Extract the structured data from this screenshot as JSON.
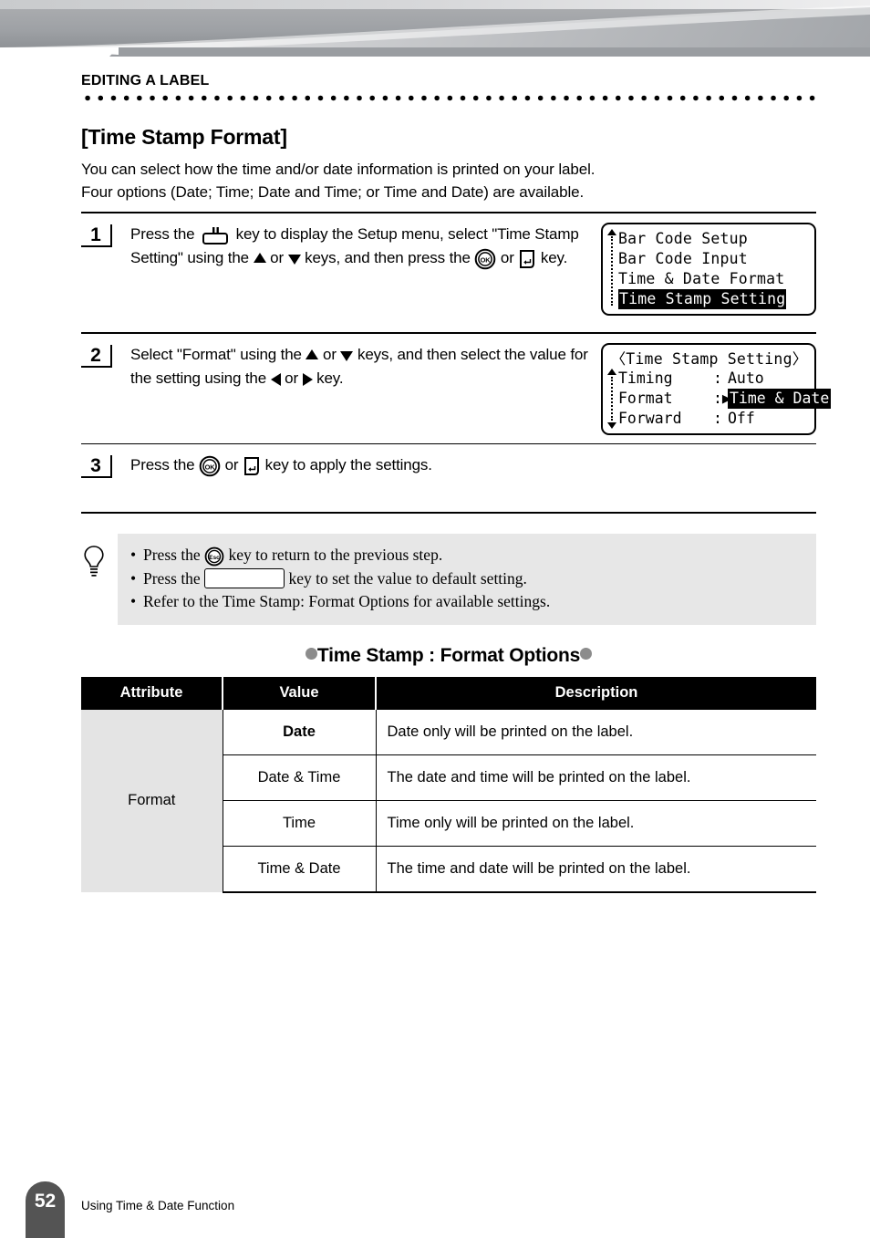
{
  "header": {
    "section_title": "EDITING A LABEL"
  },
  "topic": {
    "title": "[Time Stamp Format]",
    "intro_line1": "You can select how the time and/or date information is printed on your label.",
    "intro_line2": "Four options (Date; Time; Date and Time; or Time and Date) are available."
  },
  "steps": [
    {
      "number": "1",
      "text_a": "Press the",
      "key_1": "setup-key",
      "text_b": "key to display the Setup menu, select \"Time Stamp Setting\" using the",
      "text_c": "or",
      "text_d": "keys, and then press the",
      "text_e": "or",
      "text_f": "key."
    },
    {
      "number": "2",
      "text_a": "Select \"Format\" using the",
      "text_b": "or",
      "text_c": "keys, and then select the value for the setting using the",
      "text_d": "or",
      "text_e": "key."
    },
    {
      "number": "3",
      "text_a": "Press the",
      "text_b": "or",
      "text_c": "key to apply the settings."
    }
  ],
  "lcd1": {
    "lines": [
      "Bar Code Setup",
      "Bar Code Input",
      "Time & Date Format"
    ],
    "selected": "Time Stamp Setting"
  },
  "lcd2": {
    "title": "〈Time Stamp Setting〉",
    "rows": [
      {
        "key": "Timing",
        "sep": ":",
        "value": "Auto",
        "highlight": false
      },
      {
        "key": "Format",
        "sep": ":▶",
        "value": "Time & Date",
        "highlight": true
      },
      {
        "key": "Forward",
        "sep": ":",
        "value": "Off",
        "highlight": false
      }
    ]
  },
  "note": {
    "item1_a": "Press the",
    "item1_b": "key to return to the previous step.",
    "item2_a": "Press the",
    "item2_b": "key to set the value to default setting.",
    "item3": "Refer to the Time Stamp: Format Options for available settings."
  },
  "options_table": {
    "title": "Time Stamp : Format Options",
    "headers": [
      "Attribute",
      "Value",
      "Description"
    ],
    "attribute": "Format",
    "rows": [
      {
        "value": "Date",
        "description": "Date only will be printed on the label.",
        "default": true
      },
      {
        "value": "Date & Time",
        "description": "The date and time will be printed on the label.",
        "default": false
      },
      {
        "value": "Time",
        "description": "Time only will be printed on the label.",
        "default": false
      },
      {
        "value": "Time & Date",
        "description": "The time and date will be printed on the label.",
        "default": false
      }
    ]
  },
  "footer": {
    "page_number": "52",
    "chapter_label": "Using Time & Date Function"
  },
  "colors": {
    "note_bg": "#e7e7e7",
    "table_header_bg": "#000000",
    "attribute_cell_bg": "#e4e4e4",
    "page_tab_bg": "#545454",
    "ornament": "#8c8c8c"
  }
}
